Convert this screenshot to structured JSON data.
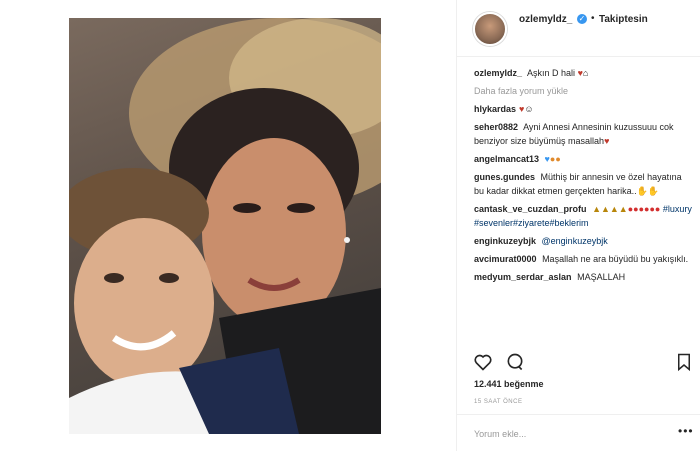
{
  "header": {
    "username": "ozlemyldz_",
    "verified_icon": "verified-badge-icon",
    "separator": "•",
    "follow_label": "Takiptesin"
  },
  "caption": {
    "username": "ozlemyldz_",
    "text": "Aşkın D hali"
  },
  "load_more": "Daha fazla yorum yükle",
  "comments": [
    {
      "user": "hlykardas",
      "text": "",
      "tags": ""
    },
    {
      "user": "seher0882",
      "text": "Ayni Annesi Annesinin kuzussuuu cok benziyor size büyümüş masallah",
      "tags": ""
    },
    {
      "user": "angelmancat13",
      "text": "",
      "tags": ""
    },
    {
      "user": "gunes.gundes",
      "text": "Müthiş bir annesin ve özel hayatına bu kadar dikkat etmen gerçekten harika..",
      "tags": ""
    },
    {
      "user": "cantask_ve_cuzdan_profu",
      "text": "",
      "tags": "#luxury #sevenler#ziyarete#beklerim"
    },
    {
      "user": "enginkuzeybjk",
      "text": "",
      "tags": "@enginkuzeybjk"
    },
    {
      "user": "avcimurat0000",
      "text": "Maşallah ne ara büyüdü bu yakışıklı.",
      "tags": ""
    },
    {
      "user": "medyum_serdar_aslan",
      "text": "MAŞALLAH",
      "tags": ""
    }
  ],
  "likes": "12.441 beğenme",
  "timestamp": "15 SAAT ÖNCE",
  "add_comment_placeholder": "Yorum ekle...",
  "more_options": "•••",
  "colors": {
    "link": "#003569",
    "muted": "#999999",
    "verified": "#3897f0"
  }
}
